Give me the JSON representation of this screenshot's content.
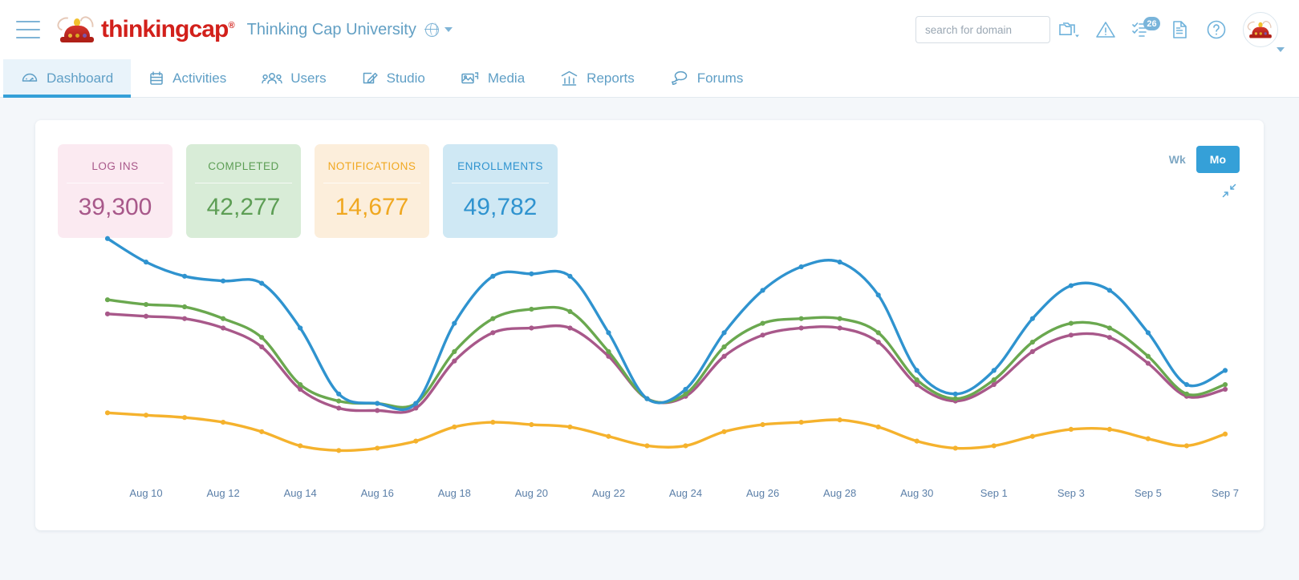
{
  "header": {
    "menu_icon": "hamburger-icon",
    "brand": "thinkingcap",
    "brand_mark": "®",
    "domain": "Thinking Cap University",
    "globe_icon": "globe-icon",
    "caret_icon": "chevron-down-icon",
    "search": {
      "placeholder": "search for domain",
      "value": ""
    },
    "icons": [
      {
        "name": "folders-icon",
        "badge": ""
      },
      {
        "name": "warning-triangle-icon",
        "badge": ""
      },
      {
        "name": "checklist-icon",
        "badge": "26"
      },
      {
        "name": "document-icon",
        "badge": ""
      },
      {
        "name": "help-circle-icon",
        "badge": ""
      }
    ],
    "avatar": "user-avatar"
  },
  "nav": {
    "tabs": [
      {
        "label": "Dashboard",
        "icon": "gauge-icon",
        "active": true
      },
      {
        "label": "Activities",
        "icon": "calendar-icon",
        "active": false
      },
      {
        "label": "Users",
        "icon": "people-icon",
        "active": false
      },
      {
        "label": "Studio",
        "icon": "pencil-icon",
        "active": false
      },
      {
        "label": "Media",
        "icon": "image-icon",
        "active": false
      },
      {
        "label": "Reports",
        "icon": "bar-chart-icon",
        "active": false
      },
      {
        "label": "Forums",
        "icon": "chat-icon",
        "active": false
      }
    ]
  },
  "stats": [
    {
      "label": "LOG INS",
      "value": "39,300",
      "bg": "#fbeaf1",
      "fg": "#a8588a"
    },
    {
      "label": "COMPLETED",
      "value": "42,277",
      "bg": "#d8ecd7",
      "fg": "#5d9e55"
    },
    {
      "label": "NOTIFICATIONS",
      "value": "14,677",
      "bg": "#fceedb",
      "fg": "#f0a821"
    },
    {
      "label": "ENROLLMENTS",
      "value": "49,782",
      "bg": "#cfe8f4",
      "fg": "#2f93cf"
    }
  ],
  "period": {
    "week_label": "Wk",
    "month_label": "Mo",
    "selected": "Mo"
  },
  "collapse_icon": "shrink-arrows-icon",
  "chart_data": {
    "type": "line",
    "title": "",
    "xlabel": "",
    "ylabel": "",
    "grid": false,
    "legend": "none",
    "smoothing": "spline",
    "markers": true,
    "ylim": [
      0,
      100
    ],
    "x": [
      "Aug 9",
      "Aug 10",
      "Aug 11",
      "Aug 12",
      "Aug 13",
      "Aug 14",
      "Aug 15",
      "Aug 16",
      "Aug 17",
      "Aug 18",
      "Aug 19",
      "Aug 20",
      "Aug 21",
      "Aug 22",
      "Aug 23",
      "Aug 24",
      "Aug 25",
      "Aug 26",
      "Aug 27",
      "Aug 28",
      "Aug 29",
      "Aug 30",
      "Aug 31",
      "Sep 1",
      "Sep 2",
      "Sep 3",
      "Sep 4",
      "Sep 5",
      "Sep 6",
      "Sep 7"
    ],
    "tick_labels": [
      "Aug 10",
      "Aug 12",
      "Aug 14",
      "Aug 16",
      "Aug 18",
      "Aug 20",
      "Aug 22",
      "Aug 24",
      "Aug 26",
      "Aug 28",
      "Aug 30",
      "Sep 1",
      "Sep 3",
      "Sep 5",
      "Sep 7"
    ],
    "tick_every": 2,
    "series": [
      {
        "name": "Enrollments",
        "color": "#2f93cf",
        "values": [
          96,
          86,
          80,
          78,
          77,
          58,
          30,
          26,
          26,
          60,
          80,
          81,
          80,
          56,
          28,
          32,
          56,
          74,
          84,
          86,
          72,
          40,
          30,
          40,
          62,
          76,
          74,
          56,
          34,
          40
        ]
      },
      {
        "name": "Completed",
        "color": "#6aa84f",
        "values": [
          70,
          68,
          67,
          62,
          54,
          34,
          27,
          26,
          26,
          48,
          62,
          66,
          65,
          48,
          28,
          30,
          50,
          60,
          62,
          62,
          56,
          36,
          28,
          36,
          52,
          60,
          58,
          46,
          30,
          34
        ]
      },
      {
        "name": "Log Ins",
        "color": "#a8588a",
        "values": [
          64,
          63,
          62,
          58,
          50,
          32,
          24,
          23,
          24,
          44,
          56,
          58,
          58,
          46,
          28,
          29,
          46,
          55,
          58,
          58,
          52,
          34,
          27,
          34,
          48,
          55,
          54,
          43,
          29,
          32
        ]
      },
      {
        "name": "Notifications",
        "color": "#f5b22d",
        "values": [
          22,
          21,
          20,
          18,
          14,
          8,
          6,
          7,
          10,
          16,
          18,
          17,
          16,
          12,
          8,
          8,
          14,
          17,
          18,
          19,
          16,
          10,
          7,
          8,
          12,
          15,
          15,
          11,
          8,
          13
        ]
      }
    ]
  }
}
